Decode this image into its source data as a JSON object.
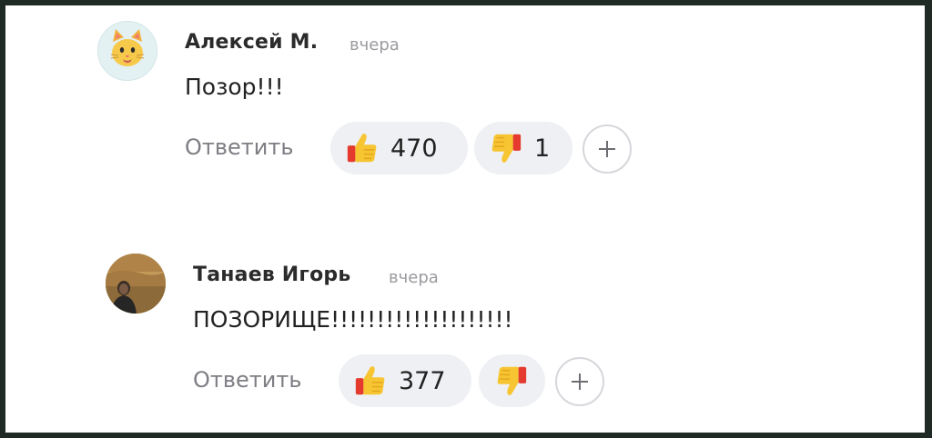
{
  "comments": [
    {
      "author": "Алексей М.",
      "date": "вчера",
      "text": "Позор!!!",
      "reply_label": "Ответить",
      "likes": "470",
      "dislikes": "1",
      "avatar_icon": "cat-face-icon"
    },
    {
      "author": "Танаев Игорь",
      "date": "вчера",
      "text": "ПОЗОРИЩЕ!!!!!!!!!!!!!!!!!!!!",
      "reply_label": "Ответить",
      "likes": "377",
      "dislikes": "",
      "avatar_icon": "user-photo"
    }
  ],
  "colors": {
    "pill_bg": "#eef0f3",
    "muted_text": "#9a9aa0",
    "thumb_yellow": "#f7c531",
    "thumb_red": "#e53b2e"
  }
}
